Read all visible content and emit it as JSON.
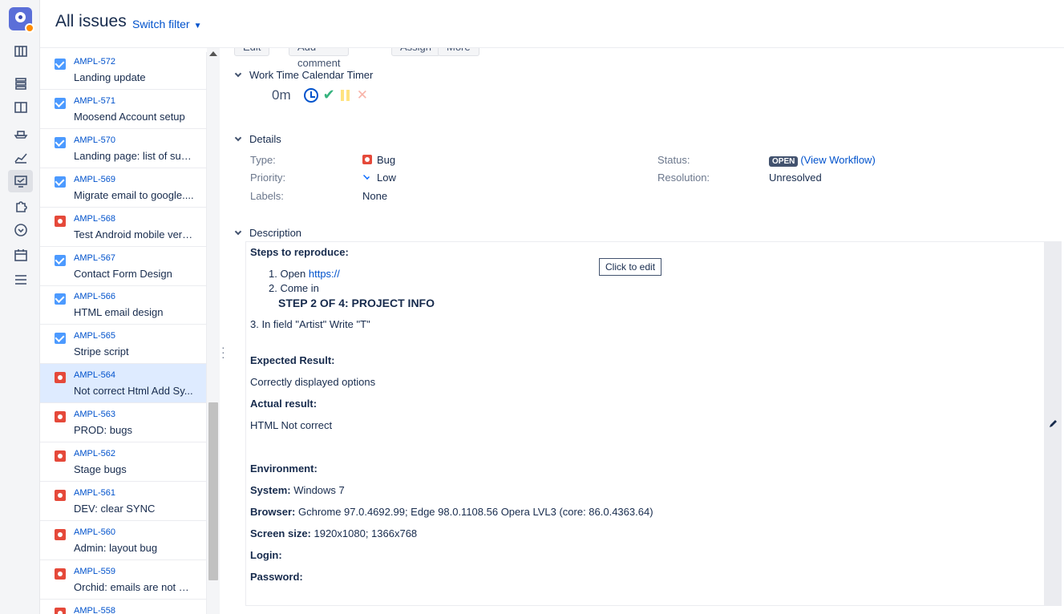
{
  "header": {
    "title": "All issues",
    "switch_filter": "Switch filter"
  },
  "rail": {
    "icons": [
      "app-logo-icon",
      "board-icon",
      "backlog-icon",
      "columns-icon",
      "ship-icon",
      "reports-icon",
      "issues-icon",
      "addons-icon",
      "clock-icon",
      "calendar-icon",
      "list-icon"
    ]
  },
  "issues": [
    {
      "key": "AMPL-572",
      "summary": "Landing update",
      "type": "task"
    },
    {
      "key": "AMPL-571",
      "summary": "Moosend Account setup",
      "type": "task"
    },
    {
      "key": "AMPL-570",
      "summary": "Landing page: list of sub...",
      "type": "task"
    },
    {
      "key": "AMPL-569",
      "summary": "Migrate email to google....",
      "type": "task"
    },
    {
      "key": "AMPL-568",
      "summary": "Test Android mobile vers...",
      "type": "bug"
    },
    {
      "key": "AMPL-567",
      "summary": "Contact Form Design",
      "type": "task"
    },
    {
      "key": "AMPL-566",
      "summary": "HTML email design",
      "type": "task"
    },
    {
      "key": "AMPL-565",
      "summary": "Stripe script",
      "type": "task"
    },
    {
      "key": "AMPL-564",
      "summary": "Not correct Html Add Sy...",
      "type": "bug",
      "selected": true
    },
    {
      "key": "AMPL-563",
      "summary": "PROD: bugs",
      "type": "bug"
    },
    {
      "key": "AMPL-562",
      "summary": "Stage bugs",
      "type": "bug"
    },
    {
      "key": "AMPL-561",
      "summary": "DEV: clear SYNC",
      "type": "bug"
    },
    {
      "key": "AMPL-560",
      "summary": "Admin: layout bug",
      "type": "bug"
    },
    {
      "key": "AMPL-559",
      "summary": "Orchid: emails are not se...",
      "type": "bug"
    },
    {
      "key": "AMPL-558",
      "summary": "",
      "type": "bug"
    }
  ],
  "toolbar": {
    "edit": "Edit",
    "add_comment": "Add comment",
    "assign": "Assign",
    "more": "More"
  },
  "timer": {
    "title": "Work Time Calendar Timer",
    "value": "0m"
  },
  "details": {
    "title": "Details",
    "type_label": "Type:",
    "type_value": "Bug",
    "priority_label": "Priority:",
    "priority_value": "Low",
    "labels_label": "Labels:",
    "labels_value": "None",
    "status_label": "Status:",
    "status_value": "OPEN",
    "status_link": "(View Workflow)",
    "resolution_label": "Resolution:",
    "resolution_value": "Unresolved"
  },
  "description": {
    "title": "Description",
    "tooltip": "Click to edit",
    "steps_heading": "Steps to reproduce:",
    "step1_prefix": "1. Open ",
    "step1_link": "https://",
    "step2": "2. Come in",
    "step2_sub": "STEP 2 OF 4: PROJECT INFO",
    "step3": "3. In field \"Artist\" Write \"T\"",
    "expected_heading": "Expected Result:",
    "expected_text": "Correctly displayed options",
    "actual_heading": "Actual result:",
    "actual_text": "HTML Not correct",
    "environment_heading": "Environment:",
    "system_label": "System:",
    "system_value": " Windows 7",
    "browser_label": "Browser:",
    "browser_value": " Gchrome 97.0.4692.99; Edge 98.0.1108.56 Opera LVL3 (core: 86.0.4363.64)",
    "screen_label": "Screen size:",
    "screen_value": " 1920x1080; 1366x768",
    "login_label": "Login:",
    "password_label": "Password:"
  }
}
